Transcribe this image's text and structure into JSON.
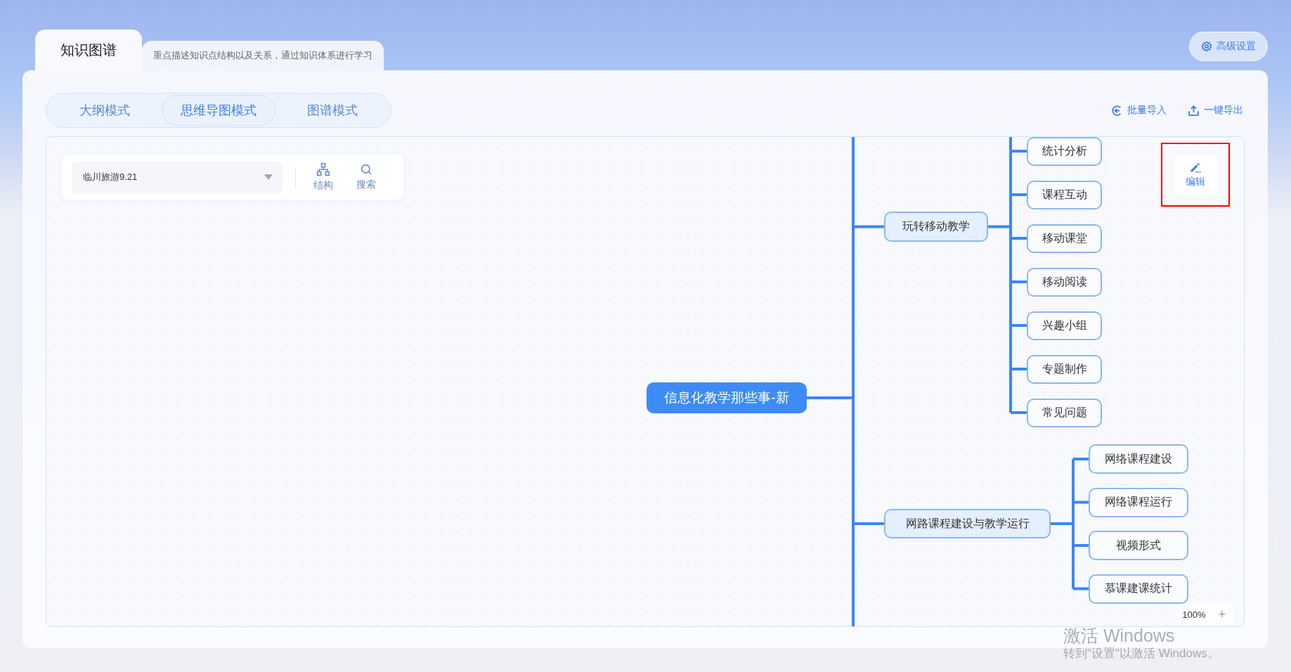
{
  "header_tabs": [
    {
      "label": "知识图谱",
      "selected": true
    },
    {
      "label": "重点描述知识点结构以及关系，通过知识体系进行学习",
      "selected": false
    }
  ],
  "settings_button": {
    "label": "高级设置"
  },
  "mode_tabs": [
    {
      "label": "大纲模式",
      "selected": false
    },
    {
      "label": "思维导图模式",
      "selected": true
    },
    {
      "label": "图谱模式",
      "selected": false
    }
  ],
  "actions": [
    {
      "kind": "import",
      "label": "批量导入"
    },
    {
      "kind": "export",
      "label": "一键导出"
    }
  ],
  "toolbar": {
    "map_select": {
      "value": "临川旅游9.21"
    },
    "buttons": [
      {
        "kind": "structure",
        "label": "结构"
      },
      {
        "kind": "search",
        "label": "搜索"
      }
    ]
  },
  "edit_button": {
    "label": "编辑",
    "highlighted": true
  },
  "mindmap": {
    "label": "信息化教学那些事-新",
    "children": [
      {
        "label": "玩转移动教学",
        "children": [
          {
            "label": "统计分析"
          },
          {
            "label": "课程互动"
          },
          {
            "label": "移动课堂"
          },
          {
            "label": "移动阅读"
          },
          {
            "label": "兴趣小组"
          },
          {
            "label": "专题制作"
          },
          {
            "label": "常见问题"
          }
        ]
      },
      {
        "label": "网路课程建设与教学运行",
        "children": [
          {
            "label": "网络课程建设"
          },
          {
            "label": "网络课程运行"
          },
          {
            "label": "视频形式"
          },
          {
            "label": "慕课建课统计"
          }
        ]
      }
    ]
  },
  "zoom": {
    "value": "100%",
    "plus": "+"
  },
  "os_notice": {
    "title": "激活 Windows",
    "subtitle": "转到\"设置\"以激活 Windows。"
  }
}
